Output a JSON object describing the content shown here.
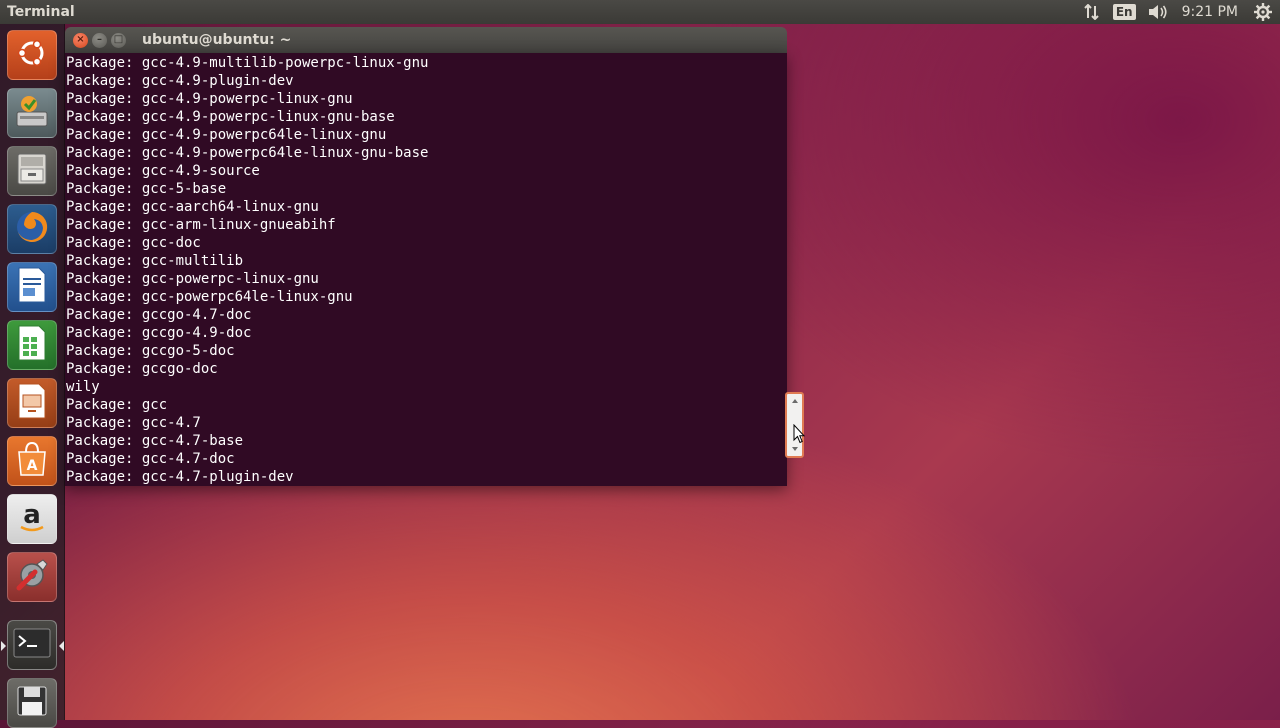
{
  "panel": {
    "app_title": "Terminal",
    "language": "En",
    "clock": "9:21 PM",
    "icons": [
      "network-arrows-icon",
      "keyboard-language-icon",
      "volume-icon",
      "gear-icon"
    ]
  },
  "launcher": {
    "items": [
      {
        "name": "dash-home",
        "icon": "ubuntu-logo-icon"
      },
      {
        "name": "system-installer",
        "icon": "installer-icon"
      },
      {
        "name": "files",
        "icon": "file-cabinet-icon"
      },
      {
        "name": "firefox",
        "icon": "firefox-icon"
      },
      {
        "name": "libreoffice-writer",
        "icon": "writer-icon"
      },
      {
        "name": "libreoffice-calc",
        "icon": "calc-icon"
      },
      {
        "name": "libreoffice-impress",
        "icon": "impress-icon"
      },
      {
        "name": "software-center",
        "icon": "shopping-bag-icon"
      },
      {
        "name": "amazon",
        "icon": "amazon-icon"
      },
      {
        "name": "system-settings",
        "icon": "wrench-gear-icon"
      },
      {
        "name": "terminal",
        "icon": "terminal-icon"
      },
      {
        "name": "drive",
        "icon": "floppy-icon"
      }
    ]
  },
  "terminal": {
    "title": "ubuntu@ubuntu: ~",
    "lines": [
      "Package: gcc-4.9-multilib-powerpc-linux-gnu",
      "Package: gcc-4.9-plugin-dev",
      "Package: gcc-4.9-powerpc-linux-gnu",
      "Package: gcc-4.9-powerpc-linux-gnu-base",
      "Package: gcc-4.9-powerpc64le-linux-gnu",
      "Package: gcc-4.9-powerpc64le-linux-gnu-base",
      "Package: gcc-4.9-source",
      "Package: gcc-5-base",
      "Package: gcc-aarch64-linux-gnu",
      "Package: gcc-arm-linux-gnueabihf",
      "Package: gcc-doc",
      "Package: gcc-multilib",
      "Package: gcc-powerpc-linux-gnu",
      "Package: gcc-powerpc64le-linux-gnu",
      "Package: gccgo-4.7-doc",
      "Package: gccgo-4.9-doc",
      "Package: gccgo-5-doc",
      "Package: gccgo-doc",
      "wily",
      "Package: gcc",
      "Package: gcc-4.7",
      "Package: gcc-4.7-base",
      "Package: gcc-4.7-doc",
      "Package: gcc-4.7-plugin-dev"
    ]
  }
}
